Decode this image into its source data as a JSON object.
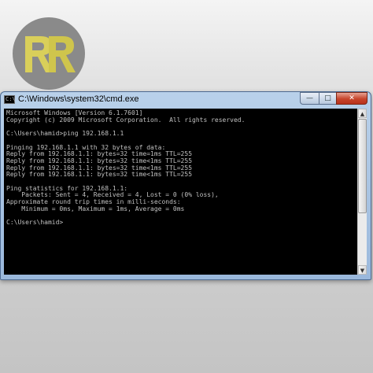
{
  "window": {
    "title": "C:\\Windows\\system32\\cmd.exe",
    "icon_name": "console-icon",
    "icon_glyph": "C:\\",
    "controls": {
      "minimize_glyph": "—",
      "maximize_glyph": "□",
      "close_glyph": "✕"
    }
  },
  "console": {
    "lines": [
      "Microsoft Windows [Version 6.1.7601]",
      "Copyright (c) 2009 Microsoft Corporation.  All rights reserved.",
      "",
      "C:\\Users\\hamid>ping 192.168.1.1",
      "",
      "Pinging 192.168.1.1 with 32 bytes of data:",
      "Reply from 192.168.1.1: bytes=32 time=1ms TTL=255",
      "Reply from 192.168.1.1: bytes=32 time<1ms TTL=255",
      "Reply from 192.168.1.1: bytes=32 time<1ms TTL=255",
      "Reply from 192.168.1.1: bytes=32 time<1ms TTL=255",
      "",
      "Ping statistics for 192.168.1.1:",
      "    Packets: Sent = 4, Received = 4, Lost = 0 (0% loss),",
      "Approximate round trip times in milli-seconds:",
      "    Minimum = 0ms, Maximum = 1ms, Average = 0ms",
      "",
      "C:\\Users\\hamid>"
    ],
    "colors": {
      "background": "#000000",
      "text": "#c0c0c0"
    }
  },
  "scrollbar": {
    "up_glyph": "▲",
    "down_glyph": "▼"
  },
  "background": {
    "logo_icon": "rr-logo-icon",
    "logo_colors": {
      "circle": "#8a8a8a",
      "letters": "#d9cf5a"
    }
  }
}
